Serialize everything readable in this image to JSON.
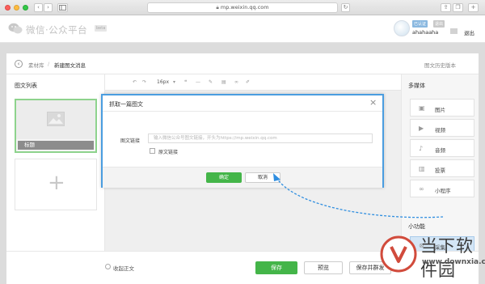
{
  "browser": {
    "url": "mp.weixin.qq.com",
    "back_label": "‹",
    "forward_label": "›"
  },
  "header": {
    "logo_text": "微信·公众平台",
    "logo_badge": "beta",
    "tag_blue": "已认证",
    "tag_gray": "退出",
    "username": "ahahaaha",
    "logout": "退出"
  },
  "breadcrumb": {
    "root": "素材库",
    "separator": "/",
    "current": "新建图文消息",
    "history": "图文历史版本"
  },
  "left_panel": {
    "title": "图文列表",
    "cover_title": "标题",
    "add_symbol": "+"
  },
  "toolbar": {
    "undo": "↶",
    "redo": "↷",
    "font_size": "16px",
    "font_caret": "▾"
  },
  "right_panel": {
    "title": "多媒体",
    "items": [
      {
        "label": "图片",
        "icon": "image-icon"
      },
      {
        "label": "视频",
        "icon": "video-icon"
      },
      {
        "label": "音频",
        "icon": "audio-icon"
      },
      {
        "label": "投票",
        "icon": "vote-icon"
      },
      {
        "label": "小程序",
        "icon": "mini-program-icon"
      }
    ],
    "func_title": "小功能",
    "func_items": [
      {
        "label": "采集",
        "icon": "collect-icon"
      }
    ]
  },
  "bottom_bar": {
    "collapse_label": "收起正文",
    "save": "保存",
    "preview": "预览",
    "send": "保存并群发"
  },
  "modal": {
    "title": "抓取一篇图文",
    "close": "×",
    "field_label": "图文链接",
    "field_placeholder": "输入微信公众号图文链接，开头为https://mp.weixin.qq.com",
    "checkbox_label": "原文链接",
    "ok": "确定",
    "cancel": "取消"
  },
  "watermark": {
    "text": "当下软件园",
    "url": "www.downxia.com"
  },
  "colors": {
    "accent_green": "#44b549",
    "modal_border": "#4a9de0",
    "arrow": "#2f8ee0"
  }
}
